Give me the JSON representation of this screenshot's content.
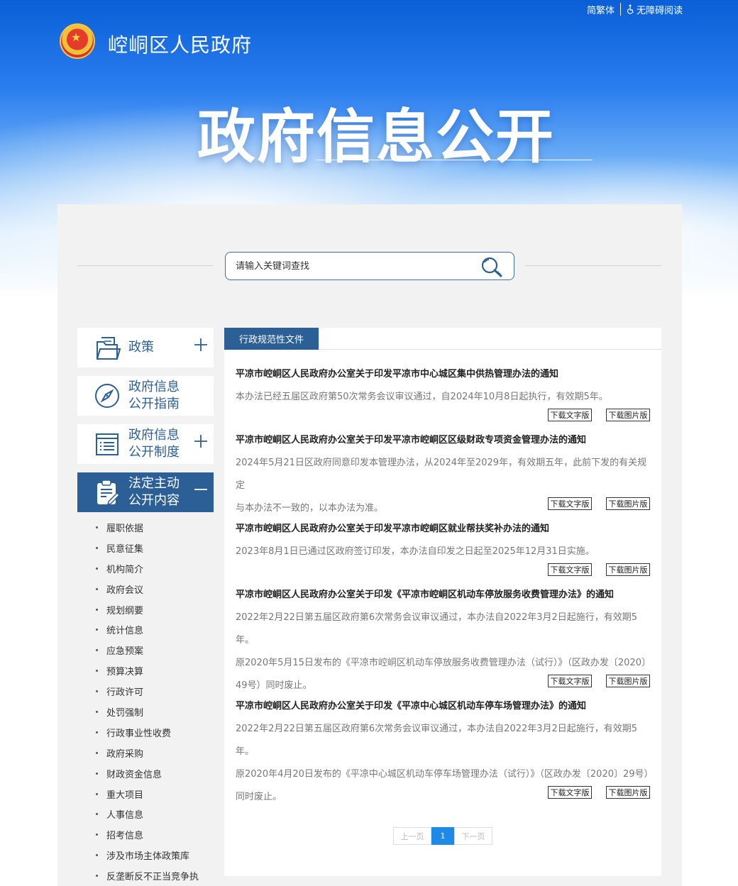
{
  "topbar": {
    "lang_label": "简繁体",
    "accessibility_label": "无障碍阅读"
  },
  "header": {
    "site_title": "崆峒区人民政府",
    "banner_title": "政府信息公开"
  },
  "search": {
    "placeholder": "请输入关键词查找"
  },
  "sidebar": {
    "items": [
      {
        "label_lines": [
          "政策"
        ],
        "expand": "plus",
        "icon": "folder-document-icon"
      },
      {
        "label_lines": [
          "政府信息",
          "公开指南"
        ],
        "expand": "",
        "icon": "compass-icon"
      },
      {
        "label_lines": [
          "政府信息",
          "公开制度"
        ],
        "expand": "plus",
        "icon": "list-document-icon"
      },
      {
        "label_lines": [
          "法定主动",
          "公开内容"
        ],
        "expand": "minus",
        "icon": "clipboard-edit-icon"
      }
    ],
    "sub_items": [
      "履职依据",
      "民意征集",
      "机构简介",
      "政府会议",
      "规划纲要",
      "统计信息",
      "应急预案",
      "预算决算",
      "行政许可",
      "处罚强制",
      "行政事业性收费",
      "政府采购",
      "财政资金信息",
      "重大项目",
      "人事信息",
      "招考信息",
      "涉及市场主体政策库",
      "反垄断反不正当竞争执"
    ]
  },
  "main": {
    "tab_label": "行政规范性文件",
    "download_text_label": "下载文字版",
    "download_image_label": "下载图片版",
    "articles": [
      {
        "title": "平凉市崆峒区人民政府办公室关于印发平凉市中心城区集中供热管理办法的通知",
        "desc": [
          "本办法已经五届区政府第50次常务会议审议通过，自2024年10月8日起执行，有效期5年。"
        ]
      },
      {
        "title": "平凉市崆峒区人民政府办公室关于印发平凉市崆峒区区级财政专项资金管理办法的通知",
        "desc": [
          "2024年5月21日区政府同意印发本管理办法，从2024年至2029年，有效期五年，此前下发的有关规定",
          "与本办法不一致的，以本办法为准。"
        ]
      },
      {
        "title": "平凉市崆峒区人民政府办公室关于印发平凉市崆峒区就业帮扶奖补办法的通知",
        "desc": [
          "2023年8月1日已通过区政府签订印发，本办法自印发之日起至2025年12月31日实施。"
        ]
      },
      {
        "title": "平凉市崆峒区人民政府办公室关于印发《平凉市崆峒区机动车停放服务收费管理办法》的通知",
        "desc": [
          "2022年2月22日第五届区政府第6次常务会议审议通过，本办法自2022年3月2日起施行，有效期5年。",
          "原2020年5月15日发布的《平凉市崆峒区机动车停放服务收费管理办法（试行）》（区政办发〔2020〕",
          "49号）同时废止。"
        ]
      },
      {
        "title": "平凉市崆峒区人民政府办公室关于印发《平凉中心城区机动车停车场管理办法》的通知",
        "desc": [
          "2022年2月22日第五届区政府第6次常务会议审议通过，本办法自2022年3月2日起施行，有效期5年。",
          "原2020年4月20日发布的《平凉中心城区机动车停车场管理办法（试行）》（区政办发〔2020〕29号）",
          "同时废止。"
        ]
      }
    ]
  },
  "pager": {
    "prev_label": "上一页",
    "current_page": "1",
    "next_label": "下一页"
  },
  "colors": {
    "primary": "#2c5f95",
    "pager_active": "#1e8ae8",
    "panel_bg": "#f2f2f2"
  }
}
